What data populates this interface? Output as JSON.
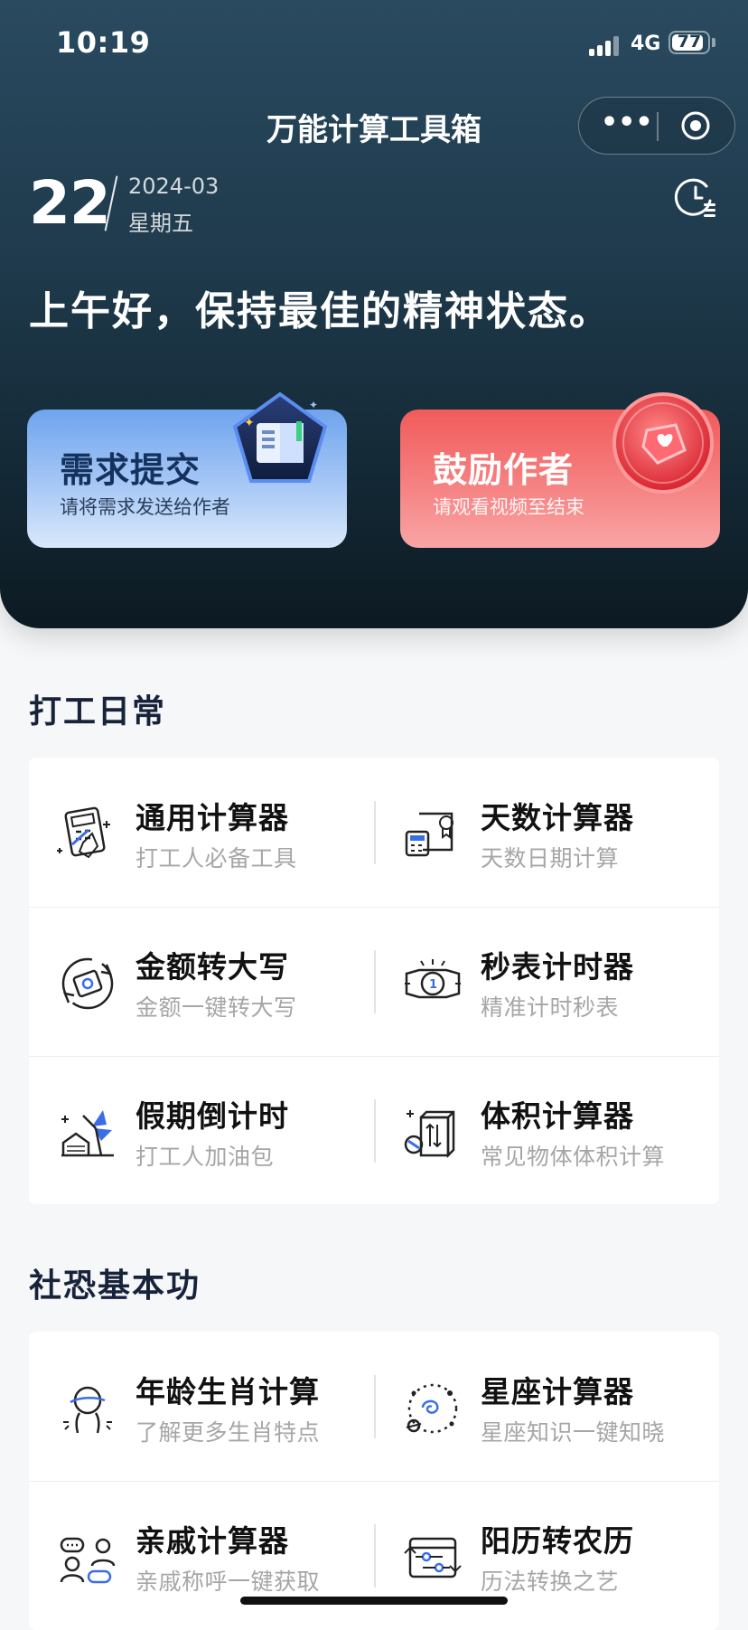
{
  "status_bar": {
    "time": "10:19",
    "network": "4G",
    "battery": "77"
  },
  "nav": {
    "title": "万能计算工具箱"
  },
  "date": {
    "day": "22",
    "year_month": "2024-03",
    "weekday": "星期五"
  },
  "greeting": "上午好，保持最佳的精神状态。",
  "promos": [
    {
      "title": "需求提交",
      "subtitle": "请将需求发送给作者"
    },
    {
      "title": "鼓励作者",
      "subtitle": "请观看视频至结束"
    }
  ],
  "sections": [
    {
      "title": "打工日常",
      "tools": [
        {
          "name": "通用计算器",
          "desc": "打工人必备工具",
          "icon": "calculator-icon"
        },
        {
          "name": "天数计算器",
          "desc": "天数日期计算",
          "icon": "day-counter-icon"
        },
        {
          "name": "金额转大写",
          "desc": "金额一键转大写",
          "icon": "money-convert-icon"
        },
        {
          "name": "秒表计时器",
          "desc": "精准计时秒表",
          "icon": "stopwatch-icon"
        },
        {
          "name": "假期倒计时",
          "desc": "打工人加油包",
          "icon": "holiday-icon"
        },
        {
          "name": "体积计算器",
          "desc": "常见物体体积计算",
          "icon": "volume-icon"
        }
      ]
    },
    {
      "title": "社恐基本功",
      "tools": [
        {
          "name": "年龄生肖计算",
          "desc": "了解更多生肖特点",
          "icon": "zodiac-age-icon"
        },
        {
          "name": "星座计算器",
          "desc": "星座知识一键知晓",
          "icon": "constellation-icon"
        },
        {
          "name": "亲戚计算器",
          "desc": "亲戚称呼一键获取",
          "icon": "relatives-icon"
        },
        {
          "name": "阳历转农历",
          "desc": "历法转换之艺",
          "icon": "calendar-convert-icon"
        }
      ]
    }
  ]
}
